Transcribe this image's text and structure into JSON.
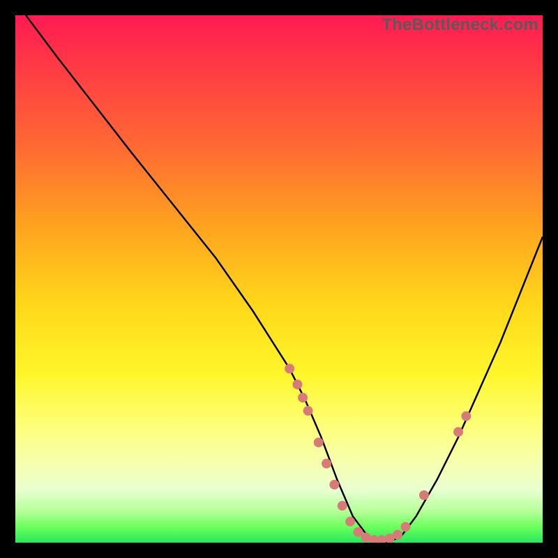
{
  "attribution": "TheBottleneck.com",
  "chart_data": {
    "type": "line",
    "title": "",
    "xlabel": "",
    "ylabel": "",
    "xlim": [
      0,
      100
    ],
    "ylim": [
      0,
      100
    ],
    "gradient_meaning": "vertical rainbow gradient (red top → green bottom) indicating bottleneck severity; minimum of curve near bottom = no bottleneck",
    "curve_description": "V-shaped curve descending from top-left to a flat minimum around x≈62–72, then rising toward upper-right",
    "series": [
      {
        "name": "bottleneck-curve",
        "x": [
          2,
          8,
          15,
          22,
          30,
          38,
          45,
          52,
          55,
          58,
          61,
          64,
          67,
          70,
          73,
          76,
          80,
          84,
          88,
          92,
          96,
          100
        ],
        "y": [
          100,
          92,
          83,
          74,
          64,
          54,
          44,
          33,
          27,
          20,
          12,
          5,
          1,
          0,
          1,
          5,
          12,
          20,
          29,
          38,
          48,
          58
        ]
      }
    ],
    "markers": {
      "description": "salmon-colored dots clustered on the descending slope, along the valley floor, and a couple on the ascending slope",
      "color": "#d87a78",
      "points_xy": [
        [
          52,
          33
        ],
        [
          53.5,
          30
        ],
        [
          54.5,
          27.5
        ],
        [
          55.5,
          25
        ],
        [
          57.5,
          19
        ],
        [
          59,
          15
        ],
        [
          60.5,
          11
        ],
        [
          62,
          7
        ],
        [
          63.5,
          4
        ],
        [
          65,
          2
        ],
        [
          66.5,
          1
        ],
        [
          68,
          0.5
        ],
        [
          69.5,
          0.5
        ],
        [
          71,
          0.8
        ],
        [
          72.5,
          1.5
        ],
        [
          74,
          3
        ],
        [
          77.5,
          9
        ],
        [
          84,
          21
        ],
        [
          85.5,
          24
        ]
      ]
    }
  }
}
